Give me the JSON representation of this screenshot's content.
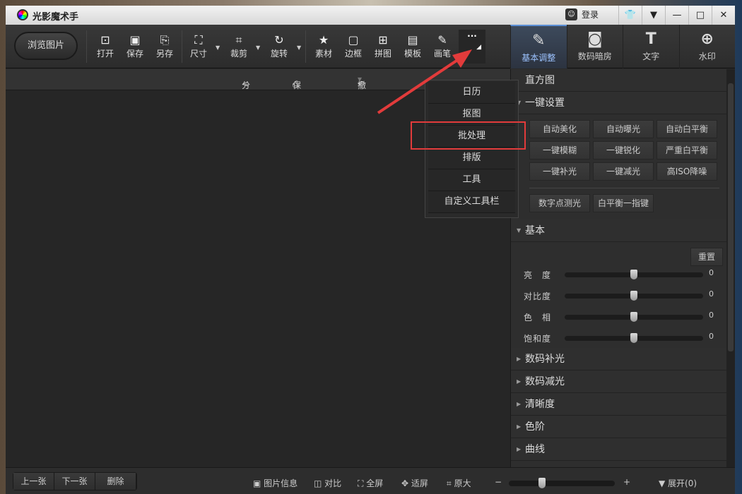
{
  "title": "光影魔术手",
  "login": "登录",
  "window_buttons": [
    "skin",
    "menu",
    "minimize",
    "maximize",
    "close"
  ],
  "browse": "浏览图片",
  "tools": [
    {
      "label": "打开",
      "icon": "open-icon"
    },
    {
      "label": "保存",
      "icon": "save-icon"
    },
    {
      "label": "另存",
      "icon": "save-as-icon"
    },
    {
      "label": "尺寸",
      "icon": "resize-icon"
    },
    {
      "label": "裁剪",
      "icon": "crop-icon"
    },
    {
      "label": "旋转",
      "icon": "rotate-icon"
    },
    {
      "label": "素材",
      "icon": "material-icon"
    },
    {
      "label": "边框",
      "icon": "frame-icon"
    },
    {
      "label": "拼图",
      "icon": "collage-icon"
    },
    {
      "label": "模板",
      "icon": "template-icon"
    },
    {
      "label": "画笔",
      "icon": "brush-icon"
    }
  ],
  "more": "···",
  "right_tabs": [
    {
      "label": "基本调整",
      "icon": "edit-icon",
      "active": true
    },
    {
      "label": "数码暗房",
      "icon": "camera-icon"
    },
    {
      "label": "文字",
      "icon": "text-icon"
    },
    {
      "label": "水印",
      "icon": "watermark-icon"
    }
  ],
  "subbar": {
    "share": "分享",
    "save_action": "保存动作",
    "undo": "撤销"
  },
  "menu": [
    "日历",
    "抠图",
    "批处理",
    "排版",
    "工具",
    "自定义工具栏"
  ],
  "highlighted": "批处理",
  "accent": "#e23b3b",
  "panel": {
    "histogram": "直方图",
    "oneclick": "一键设置",
    "oneclick_buttons": [
      "自动美化",
      "自动曝光",
      "自动白平衡",
      "一键模糊",
      "一键锐化",
      "严重白平衡",
      "一键补光",
      "一键减光",
      "高ISO降噪"
    ],
    "extra_buttons": [
      "数字点测光",
      "白平衡一指键"
    ],
    "basic": "基本",
    "reset": "重置",
    "sliders": [
      {
        "label": "亮　度",
        "value": "0"
      },
      {
        "label": "对比度",
        "value": "0"
      },
      {
        "label": "色　相",
        "value": "0"
      },
      {
        "label": "饱和度",
        "value": "0"
      }
    ],
    "sections": [
      "数码补光",
      "数码减光",
      "清晰度",
      "色阶",
      "曲线"
    ]
  },
  "bottom": {
    "prev": "上一张",
    "next": "下一张",
    "delete": "删除",
    "info": "图片信息",
    "compare": "对比",
    "fullscreen": "全屏",
    "fit": "适屏",
    "original": "原大",
    "minus": "−",
    "plus": "+",
    "expand": "展开(0)",
    "zoom_level": 0.3
  }
}
